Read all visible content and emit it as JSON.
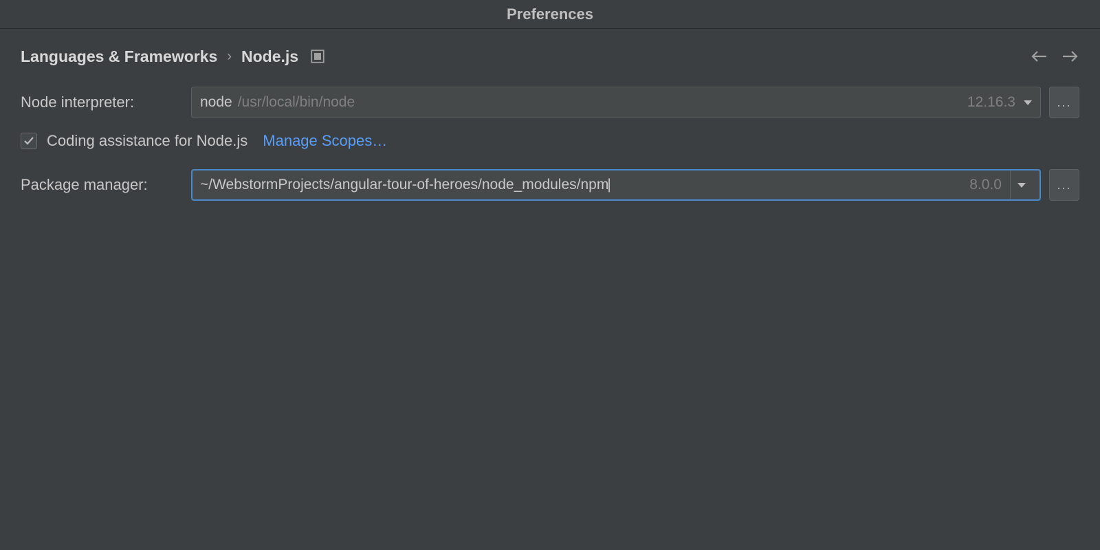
{
  "window": {
    "title": "Preferences"
  },
  "breadcrumb": {
    "parent": "Languages & Frameworks",
    "current": "Node.js"
  },
  "form": {
    "node_interpreter_label": "Node interpreter:",
    "node_interpreter_primary": "node",
    "node_interpreter_path": "/usr/local/bin/node",
    "node_interpreter_version": "12.16.3",
    "coding_assistance_label": "Coding assistance for Node.js",
    "coding_assistance_checked": true,
    "manage_scopes_label": "Manage Scopes…",
    "package_manager_label": "Package manager:",
    "package_manager_path": "~/WebstormProjects/angular-tour-of-heroes/node_modules/npm",
    "package_manager_version": "8.0.0",
    "browse_button_label": "..."
  }
}
